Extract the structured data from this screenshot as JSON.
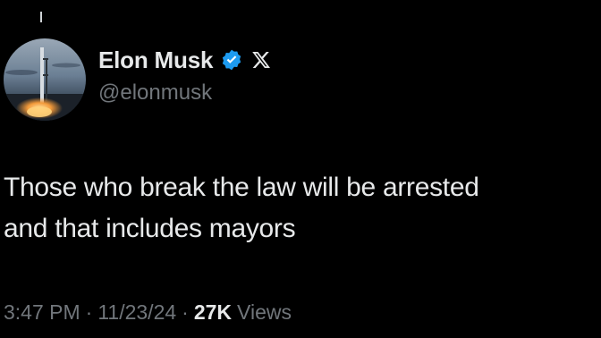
{
  "author": {
    "display_name": "Elon Musk",
    "handle": "@elonmusk",
    "avatar_icon": "starship-launch-avatar",
    "verified_icon": "verified-badge-icon",
    "affiliation_icon": "x-logo-icon"
  },
  "tweet": {
    "text": "Those who break the law will be arrested\nand that includes mayors"
  },
  "meta": {
    "time": "3:47 PM",
    "separator": "·",
    "date": "11/23/24",
    "views_count": "27K",
    "views_label": "Views"
  },
  "colors": {
    "background": "#000000",
    "primary_text": "#e7e9ea",
    "secondary_text": "#71767b",
    "verified_blue": "#1d9bf0"
  }
}
